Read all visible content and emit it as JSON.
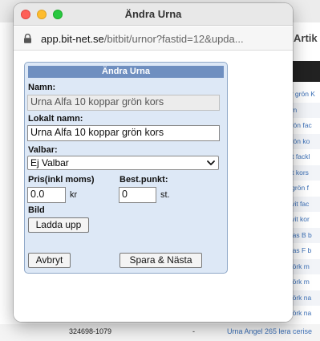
{
  "background": {
    "header": "Artik",
    "links": [
      "ur grön K",
      "arn",
      "grön fac",
      "grön ko",
      "vit fackl",
      "vit kors",
      "r grön f",
      "r vit fac",
      "r vit kor",
      "glas B b",
      "glas F b",
      "björk m",
      "björk m",
      "björk na",
      "björk na"
    ],
    "bottom_row": {
      "id": "324698-1079",
      "dash": "-",
      "product": "Urna Angel 265 lera cerise"
    }
  },
  "window": {
    "title": "Ändra Urna",
    "url_host": "app.bit-net.se",
    "url_path": "/bitbit/urnor?fastid=12&upda..."
  },
  "form": {
    "header": "Ändra Urna",
    "namn_label": "Namn:",
    "namn_value": "Urna  Alfa 10 koppar grön kors",
    "lokalt_label": "Lokalt namn:",
    "lokalt_value": "Urna  Alfa 10 koppar grön kors",
    "valbar_label": "Valbar:",
    "valbar_value": "Ej Valbar",
    "pris_label": "Pris(inkl moms)",
    "pris_value": "0.0",
    "pris_unit": "kr",
    "bestpunkt_label": "Best.punkt:",
    "bestpunkt_value": "0",
    "bestpunkt_unit": "st.",
    "bild_label": "Bild",
    "upload_button": "Ladda upp",
    "cancel_button": "Avbryt",
    "save_next_button": "Spara & Nästa"
  },
  "colors": {
    "panel_bg": "#dde8f6",
    "panel_header": "#6f8fc0",
    "link": "#3b6fb6"
  },
  "icons": [
    "lock-icon",
    "chevron-down-icon"
  ]
}
